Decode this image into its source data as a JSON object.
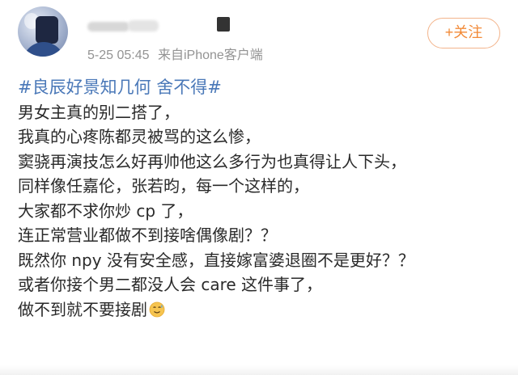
{
  "header": {
    "meta_time": "5-25 05:45",
    "meta_source": "来自iPhone客户端",
    "follow_label": "+关注"
  },
  "post": {
    "hashtag": "#良辰好景知几何 舍不得#",
    "lines": [
      "男女主真的别二搭了，",
      "我真的心疼陈都灵被骂的这么惨，",
      "窦骁再演技怎么好再帅他这么多行为也真得让人下头，",
      "同样像任嘉伦，张若昀，每一个这样的，",
      "大家都不求你炒 cp 了，",
      "连正常营业都做不到接啥偶像剧？？",
      "既然你 npy 没有安全感，直接嫁富婆退圈不是更好？？",
      "或者你接个男二都没人会 care 这件事了，",
      "做不到就不要接剧"
    ],
    "emoji": "sweat-smile-emoji"
  },
  "colors": {
    "accent": "#f28a37",
    "hashtag": "#4a78b8",
    "meta": "#939393",
    "text": "#2a2a2a"
  }
}
